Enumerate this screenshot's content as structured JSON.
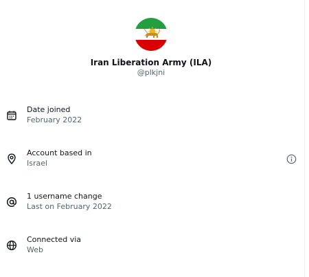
{
  "profile": {
    "display_name": "Iran Liberation Army (ILA)",
    "handle": "@plkjni",
    "avatar": {
      "icon": "iran-lion-and-sun-flag-avatar",
      "colors": {
        "green": "#239f40",
        "white": "#ffffff",
        "red": "#da0000",
        "emblem": "#d4a017"
      }
    }
  },
  "details": [
    {
      "icon": "calendar-icon",
      "title": "Date joined",
      "value": "February 2022"
    },
    {
      "icon": "location-pin-icon",
      "title": "Account based in",
      "value": "Israel",
      "info_icon": "info-icon"
    },
    {
      "icon": "at-sign-icon",
      "title": "1 username change",
      "value": "Last on February 2022"
    },
    {
      "icon": "globe-icon",
      "title": "Connected via",
      "value": "Web"
    }
  ],
  "colors": {
    "primary_text": "#0f1419",
    "secondary_text": "#536471",
    "divider": "#eff3f4"
  }
}
